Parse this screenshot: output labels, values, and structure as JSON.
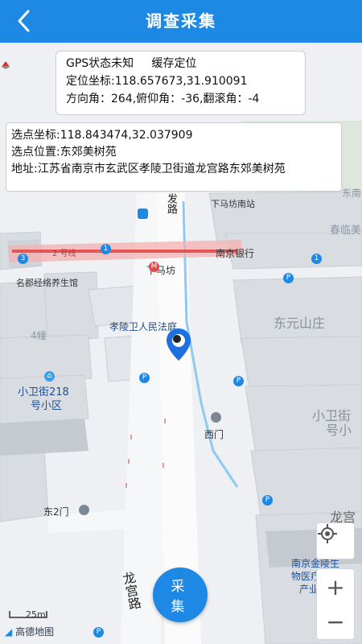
{
  "header": {
    "title": "调查采集",
    "back_icon": "back-arrow-icon"
  },
  "gps_info": {
    "status": "GPS状态未知",
    "cache": "缓存定位",
    "coord_label": "定位坐标:",
    "coord_value": "118.657673,31.910091",
    "orientation": "方向角：264,俯仰角：-36,翻滚角：-4"
  },
  "site_info": {
    "coord_label": "选点坐标:",
    "coord_value": "118.843474,32.037909",
    "location_label": "选点位置:",
    "location_value": "东郊美树苑",
    "address_label": "地址:",
    "address_value": "江苏省南京市玄武区孝陵卫街道龙宫路东郊美树苑"
  },
  "map": {
    "labels": {
      "road_top": "发",
      "road_top2": "路",
      "xiamafang_north": "下马坊南站",
      "dongmen": "东南",
      "line2": "2 号线",
      "xiamafang_station": "下马坊",
      "nanjing_bank": "南京银行",
      "chunxiuyuan": "春临美",
      "mingjun": "名郡经络养生馆",
      "court": "孝陵卫人民法庭",
      "dongyuan": "东元山庄",
      "building4": "4幢",
      "xiaowei218": "小卫街218",
      "xiaowei218b": "号小区",
      "xiaoweijie": "小卫街",
      "xiaoweijie2": "号小",
      "ximen": "西门",
      "dong2men": "东2门",
      "longgong": "龙宫",
      "jinling1": "南京金陵生",
      "jinling2": "物医疗科技",
      "jinling3": "产业园",
      "road_bottom": "龙宫路",
      "scale": "25m",
      "logo": "高德地图"
    },
    "badges": {
      "line2_num": "3",
      "line1_num": "1",
      "bus_num": "1"
    },
    "icons": {
      "compass": "compass-icon",
      "marker": "location-pin-icon",
      "locate": "locate-crosshair-icon",
      "zoom_in": "plus-icon",
      "zoom_out": "minus-icon"
    },
    "colors": {
      "primary": "#1e88e5",
      "metro": "#e04b4b",
      "water": "#8ec9f2"
    }
  },
  "controls": {
    "collect_label": "采 集",
    "zoom_in": "+",
    "zoom_out": "−"
  }
}
